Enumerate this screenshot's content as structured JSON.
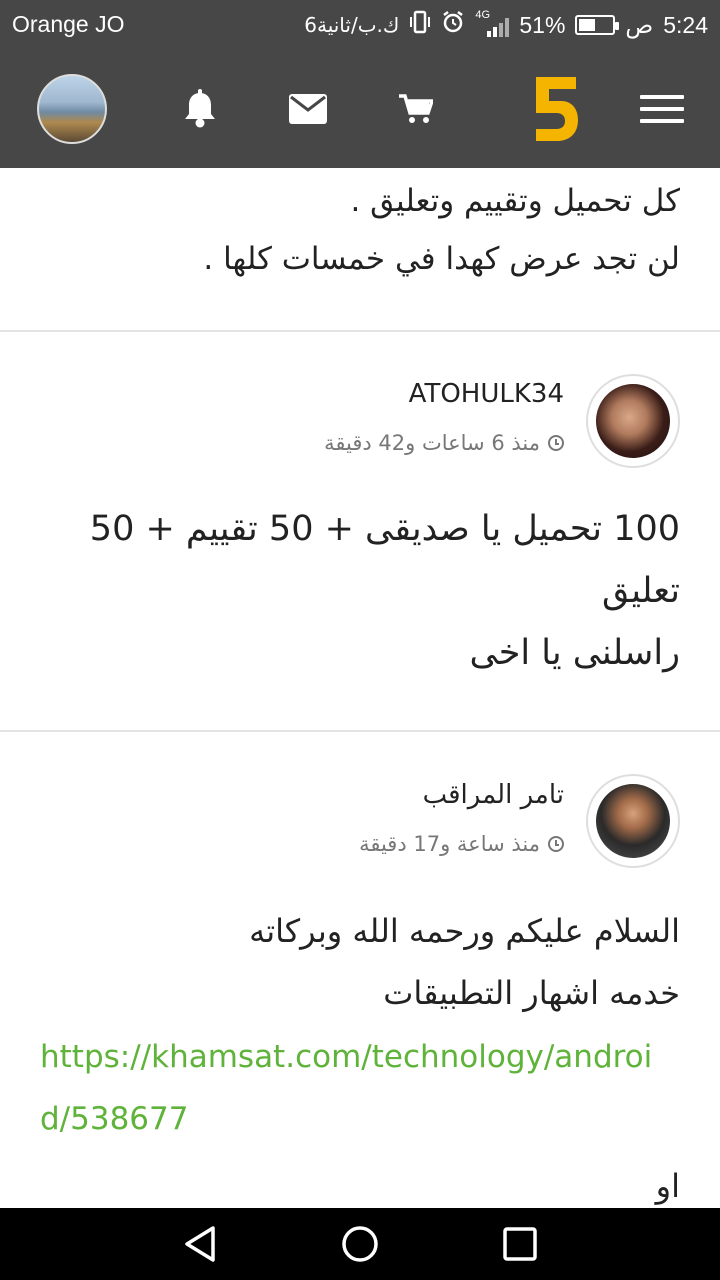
{
  "status_bar": {
    "carrier": "Orange JO",
    "time": "5:24",
    "ampm": "ص",
    "battery_percent": "51%",
    "battery_level": 0.51,
    "network": "4G",
    "speed": "6ك.ب/ثانية"
  },
  "app_bar": {
    "icons": [
      "avatar",
      "bell-icon",
      "mail-icon",
      "cart-icon",
      "logo",
      "menu-icon"
    ],
    "logo_text": "5",
    "accent": "#f5b400",
    "background": "#474747"
  },
  "top_post": {
    "lines": [
      "كل تحميل وتقييم وتعليق .",
      "لن تجد عرض كهدا في خمسات كلها ."
    ]
  },
  "comments": [
    {
      "username": "ATOHULK34",
      "time": "منذ 6 ساعات و42 دقيقة",
      "lines": [
        "100 تحميل يا صديقى + 50 تقييم + 50",
        "تعليق",
        "راسلنى يا اخى"
      ]
    },
    {
      "username": "تامر المراقب",
      "time": "منذ ساعة و17 دقيقة",
      "lines": [
        "السلام عليكم ورحمه الله وبركاته",
        "خدمه اشهار التطبيقات"
      ],
      "link": "https://khamsat.com/technology/android/538677",
      "after_link": "او"
    }
  ],
  "link_color": "#5fb33a"
}
